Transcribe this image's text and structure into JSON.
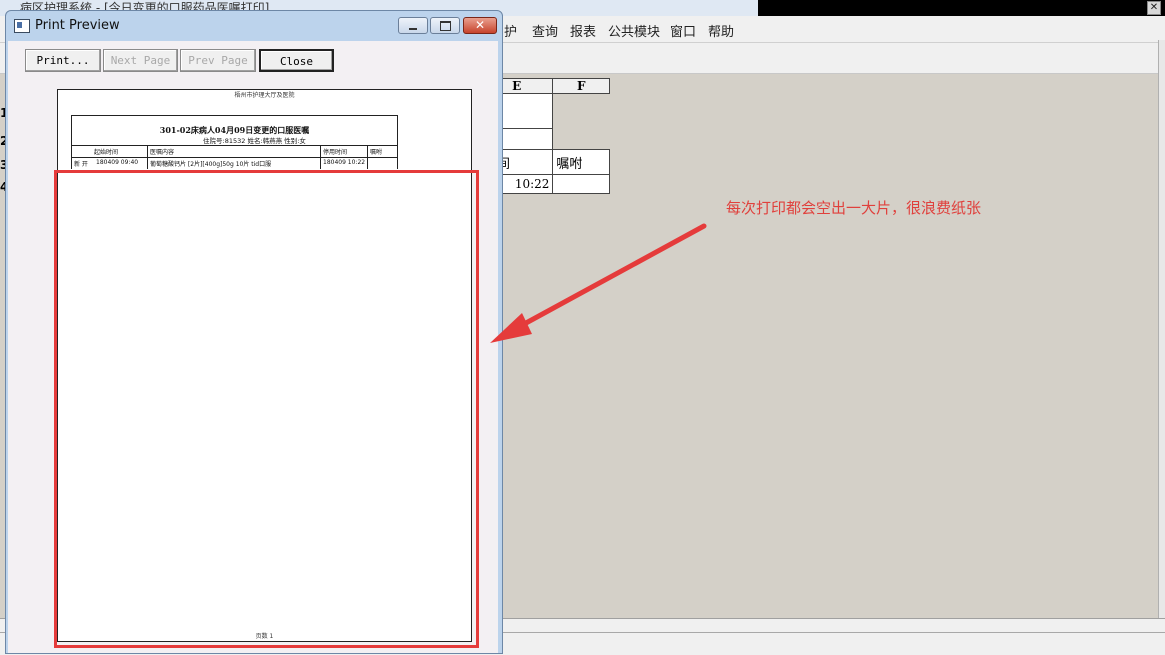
{
  "background_app": {
    "title": "病区护理系统 - [今日变更的口服药品医嘱打印]",
    "menu": [
      "护",
      "查询",
      "报表",
      "公共模块",
      "窗口",
      "帮助"
    ],
    "sheet": {
      "columns": [
        "E",
        "F"
      ],
      "row_header": [
        "时间",
        "嘱咐"
      ],
      "row_value": [
        "10:22",
        ""
      ]
    },
    "row_numbers": [
      "1",
      "2",
      "3",
      "4"
    ]
  },
  "dialog": {
    "title": "Print Preview",
    "buttons": {
      "print": "Print...",
      "next_page": "Next Page",
      "prev_page": "Prev Page",
      "close": "Close"
    },
    "page": {
      "hospital": "梧州市护理大厅及医院",
      "report_title": "301-02床病人04月09日变更的口服医嘱",
      "patient_info": "住院号:81532   姓名:韩燕燕   性别:女",
      "table_headers": [
        "起始时间",
        "医嘱内容",
        "停用时间",
        "嘱咐"
      ],
      "row": {
        "status": "新 开",
        "start": "180409 09:40",
        "content": "葡萄糖酸钙片 [2片][400g]50g 10片 tid口服",
        "stop": "180409 10:22",
        "note": ""
      },
      "page_number": "页数 1"
    }
  },
  "annotation": {
    "text": "每次打印都会空出一大片，很浪费纸张",
    "color": "#e0403c"
  }
}
